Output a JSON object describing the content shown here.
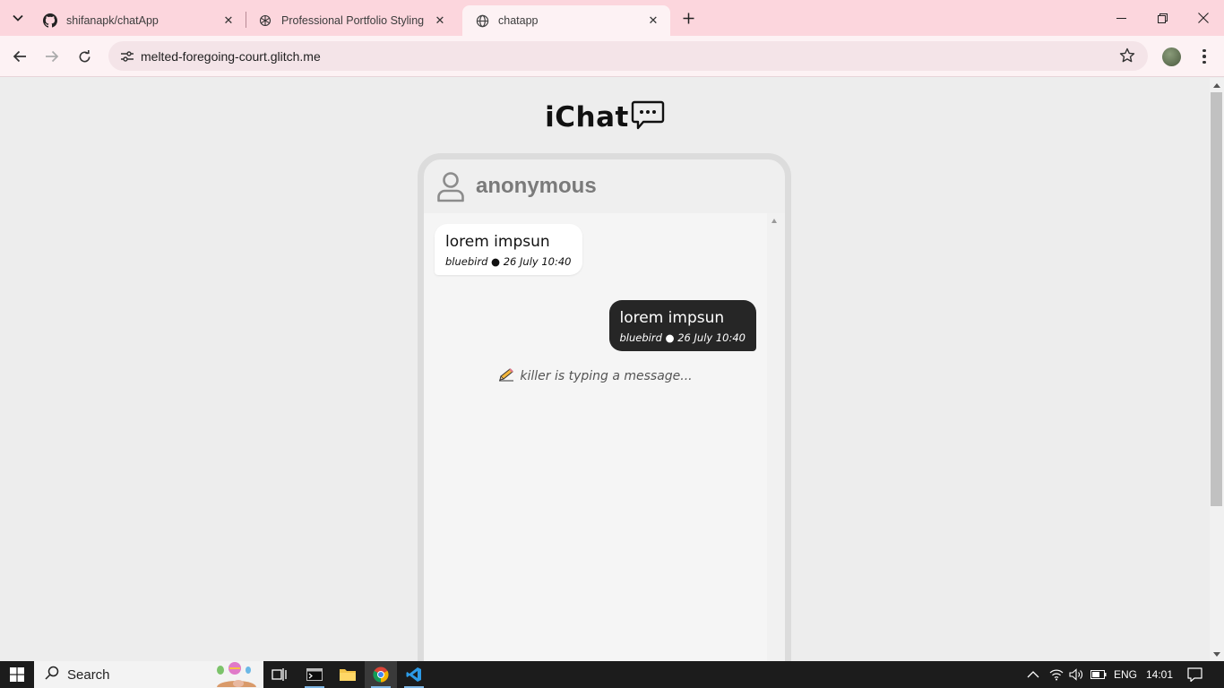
{
  "browser": {
    "tabs": [
      {
        "title": "shifanapk/chatApp",
        "icon": "github-icon",
        "active": false
      },
      {
        "title": "Professional Portfolio Styling",
        "icon": "openai-icon",
        "active": false
      },
      {
        "title": "chatapp",
        "icon": "globe-icon",
        "active": true
      }
    ],
    "url": "melted-foregoing-court.glitch.me"
  },
  "app": {
    "title": "iChat",
    "header": {
      "username": "anonymous"
    },
    "messages": [
      {
        "direction": "incoming",
        "text": "lorem impsun",
        "meta": "bluebird ● 26 July 10:40"
      },
      {
        "direction": "outgoing",
        "text": "lorem impsun",
        "meta": "bluebird ● 26 July 10:40"
      }
    ],
    "typing_indicator": "killer is typing a message..."
  },
  "taskbar": {
    "search_placeholder": "Search",
    "language": "ENG",
    "time": "14:01"
  },
  "colors": {
    "tab_strip": "#fcd6dd",
    "toolbar": "#fdf2f4",
    "outgoing_bubble": "#262626",
    "incoming_bubble": "#ffffff",
    "page_background": "#ededed"
  }
}
